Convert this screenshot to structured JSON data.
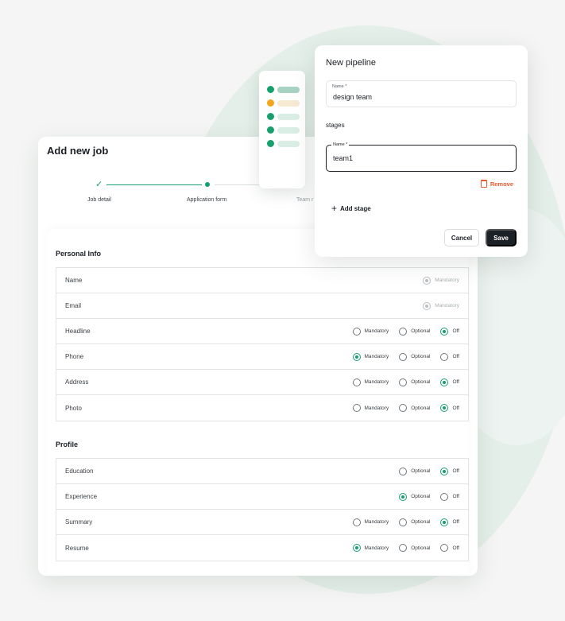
{
  "colors": {
    "accent": "#16a06e",
    "danger": "#ef5a2d",
    "dark": "#1c2127",
    "orange": "#f2a51d"
  },
  "job": {
    "title": "Add new job",
    "steps": [
      {
        "label": "Job detail",
        "status": "done"
      },
      {
        "label": "Application form",
        "status": "current"
      },
      {
        "label": "Team r",
        "status": "pending"
      }
    ],
    "sections": [
      {
        "title": "Personal Info",
        "fields": [
          {
            "label": "Name",
            "options": [
              {
                "label": "Mandatory",
                "selected": true,
                "disabled": true
              }
            ]
          },
          {
            "label": "Email",
            "options": [
              {
                "label": "Mandatory",
                "selected": true,
                "disabled": true
              }
            ]
          },
          {
            "label": "Headline",
            "options": [
              {
                "label": "Mandatory",
                "selected": false
              },
              {
                "label": "Optional",
                "selected": false
              },
              {
                "label": "Off",
                "selected": true
              }
            ]
          },
          {
            "label": "Phone",
            "options": [
              {
                "label": "Mandatory",
                "selected": true
              },
              {
                "label": "Optional",
                "selected": false
              },
              {
                "label": "Off",
                "selected": false
              }
            ]
          },
          {
            "label": "Address",
            "options": [
              {
                "label": "Mandatory",
                "selected": false
              },
              {
                "label": "Optional",
                "selected": false
              },
              {
                "label": "Off",
                "selected": true
              }
            ]
          },
          {
            "label": "Photo",
            "options": [
              {
                "label": "Mandatory",
                "selected": false
              },
              {
                "label": "Optional",
                "selected": false
              },
              {
                "label": "Off",
                "selected": true
              }
            ]
          }
        ]
      },
      {
        "title": "Profile",
        "fields": [
          {
            "label": "Education",
            "options": [
              {
                "label": "Optional",
                "selected": false
              },
              {
                "label": "Off",
                "selected": true
              }
            ]
          },
          {
            "label": "Experience",
            "options": [
              {
                "label": "Optional",
                "selected": true
              },
              {
                "label": "Off",
                "selected": false
              }
            ]
          },
          {
            "label": "Summary",
            "options": [
              {
                "label": "Mandatory",
                "selected": false
              },
              {
                "label": "Optional",
                "selected": false
              },
              {
                "label": "Off",
                "selected": true
              }
            ]
          },
          {
            "label": "Resume",
            "options": [
              {
                "label": "Mandatory",
                "selected": true
              },
              {
                "label": "Optional",
                "selected": false
              },
              {
                "label": "Off",
                "selected": false
              }
            ]
          }
        ]
      }
    ]
  },
  "preview": {
    "rows": [
      {
        "dot": "#16a06e",
        "bar": "#a8d2c1"
      },
      {
        "dot": "#f2a51d",
        "bar": "#f6ead3"
      },
      {
        "dot": "#16a06e",
        "bar": "#dbeee6"
      },
      {
        "dot": "#16a06e",
        "bar": "#dbeee6"
      },
      {
        "dot": "#16a06e",
        "bar": "#dbeee6"
      }
    ]
  },
  "pipeline": {
    "title": "New pipeline",
    "name_label": "Name *",
    "name_value": "design team",
    "stages_label": "stages",
    "stage_label": "Name *",
    "stage_value": "team1",
    "remove_label": "Remove",
    "add_stage_label": "Add stage",
    "cancel_label": "Cancel",
    "save_label": "Save"
  }
}
